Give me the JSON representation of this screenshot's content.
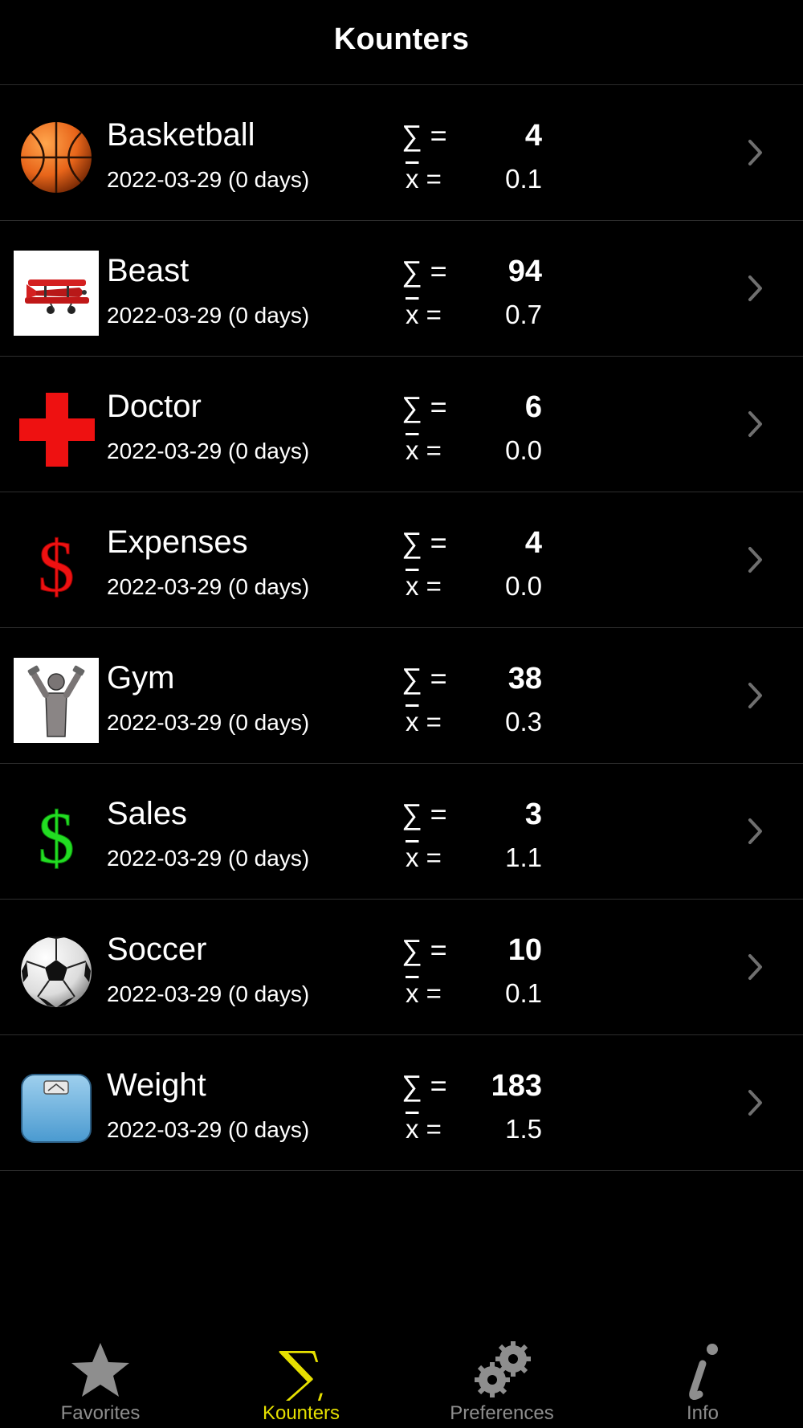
{
  "header": {
    "title": "Kounters"
  },
  "labels": {
    "sum": "∑ =",
    "mean_symbol": "x",
    "mean_eq": " ="
  },
  "counters": [
    {
      "name": "Basketball",
      "date": "2022-03-29 (0 days)",
      "sum": "4",
      "mean": "0.1",
      "icon": "basketball-icon"
    },
    {
      "name": "Beast",
      "date": "2022-03-29 (0 days)",
      "sum": "94",
      "mean": "0.7",
      "icon": "airplane-icon"
    },
    {
      "name": "Doctor",
      "date": "2022-03-29 (0 days)",
      "sum": "6",
      "mean": "0.0",
      "icon": "red-cross-icon"
    },
    {
      "name": "Expenses",
      "date": "2022-03-29 (0 days)",
      "sum": "4",
      "mean": "0.0",
      "icon": "red-dollar-icon"
    },
    {
      "name": "Gym",
      "date": "2022-03-29 (0 days)",
      "sum": "38",
      "mean": "0.3",
      "icon": "dumbbell-person-icon"
    },
    {
      "name": "Sales",
      "date": "2022-03-29 (0 days)",
      "sum": "3",
      "mean": "1.1",
      "icon": "green-dollar-icon"
    },
    {
      "name": "Soccer",
      "date": "2022-03-29 (0 days)",
      "sum": "10",
      "mean": "0.1",
      "icon": "soccer-ball-icon"
    },
    {
      "name": "Weight",
      "date": "2022-03-29 (0 days)",
      "sum": "183",
      "mean": "1.5",
      "icon": "scale-icon"
    }
  ],
  "tabbar": {
    "active": "Kounters",
    "active_color": "#e6e000",
    "inactive_color": "#8e8e8e",
    "tabs": [
      {
        "label": "Favorites",
        "icon": "star-icon"
      },
      {
        "label": "Kounters",
        "icon": "sigma-icon"
      },
      {
        "label": "Preferences",
        "icon": "gears-icon"
      },
      {
        "label": "Info",
        "icon": "info-icon"
      }
    ]
  }
}
